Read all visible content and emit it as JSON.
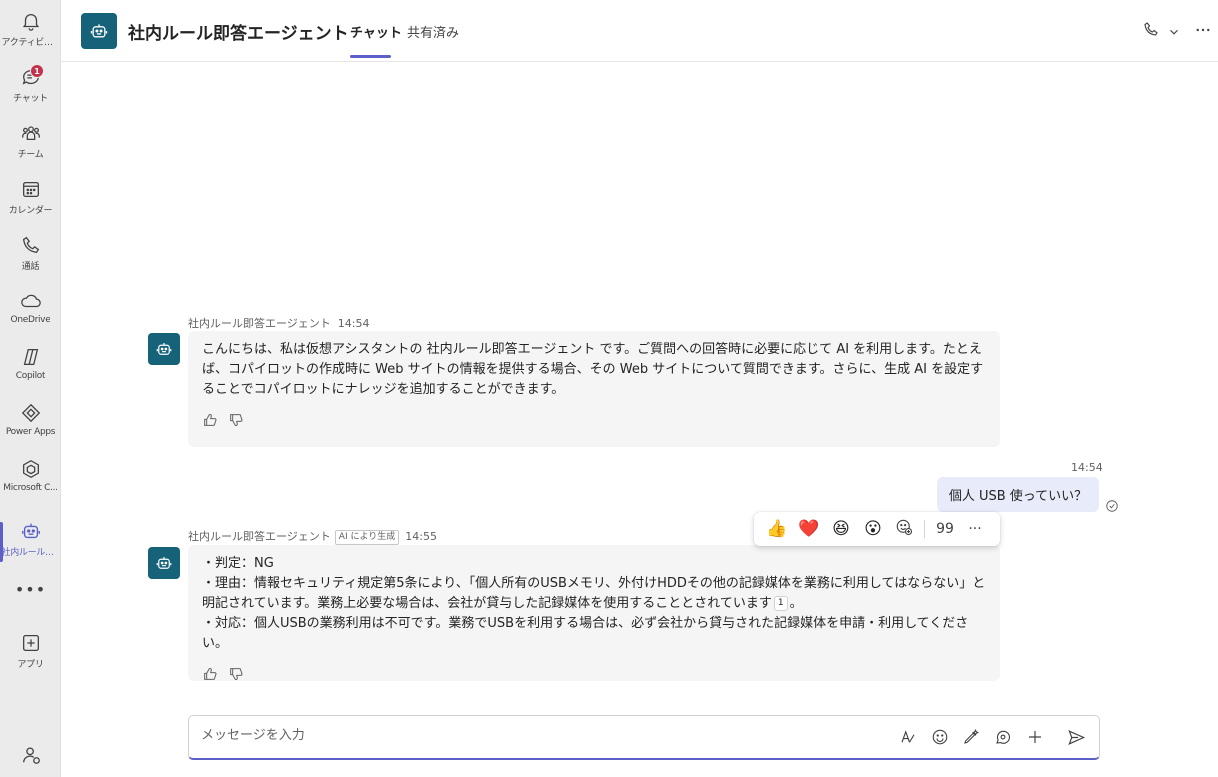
{
  "rail": {
    "items": [
      {
        "label": "アクティビティ",
        "icon": "bell-icon"
      },
      {
        "label": "チャット",
        "icon": "chat-icon",
        "badge": "1"
      },
      {
        "label": "チーム",
        "icon": "teams-icon"
      },
      {
        "label": "カレンダー",
        "icon": "calendar-icon"
      },
      {
        "label": "通話",
        "icon": "phone-icon"
      },
      {
        "label": "OneDrive",
        "icon": "cloud-icon"
      },
      {
        "label": "Copilot",
        "icon": "copilot-icon"
      },
      {
        "label": "Power Apps",
        "icon": "powerapps-icon"
      },
      {
        "label": "Microsoft C...",
        "icon": "microsoft-copilot-studio-icon"
      },
      {
        "label": "社内ルール即...",
        "icon": "bot-icon"
      },
      {
        "label": "アプリ",
        "icon": "add-apps-icon"
      }
    ],
    "more_label": "•••"
  },
  "header": {
    "title": "社内ルール即答エージェント",
    "tabs": [
      {
        "label": "チャット",
        "active": true
      },
      {
        "label": "共有済み",
        "active": false
      }
    ]
  },
  "messages": {
    "m1": {
      "sender": "社内ルール即答エージェント",
      "time": "14:54",
      "text": "こんにちは、私は仮想アシスタントの 社内ルール即答エージェント です。ご質問への回答時に必要に応じて AI を利用します。たとえば、コパイロットの作成時に Web サイトの情報を提供する場合、その Web サイトについて質問できます。さらに、生成 AI を設定することでコパイロットにナレッジを追加することができます。"
    },
    "m2": {
      "time": "14:54",
      "text": "個人 USB 使っていい？"
    },
    "m3": {
      "sender": "社内ルール即答エージェント",
      "ai_tag": "AI により生成",
      "time": "14:55",
      "line1": "・判定：NG",
      "line2": "・理由：情報セキュリティ規定第5条により、「個人所有のUSBメモリ、外付けHDDその他の記録媒体を業務に利用してはならない」と明記されています。業務上必要な場合は、会社が貸与した記録媒体を使用することとされています",
      "citation": "1",
      "line2_end": "。",
      "line3": "・対応：個人USBの業務利用は不可です。業務でUSBを利用する場合は、必ず会社から貸与された記録媒体を申請・利用してください。"
    }
  },
  "reactions": {
    "emojis": [
      "👍",
      "❤️",
      "😆",
      "😮"
    ],
    "quote_label": "99",
    "more_label": "···"
  },
  "compose": {
    "placeholder": "メッセージを入力"
  },
  "colors": {
    "accent": "#5b5fc7",
    "bot_avatar": "#156279",
    "my_bubble": "#e8ebfa",
    "bot_bubble": "#f5f5f5",
    "badge": "#c4314b"
  }
}
